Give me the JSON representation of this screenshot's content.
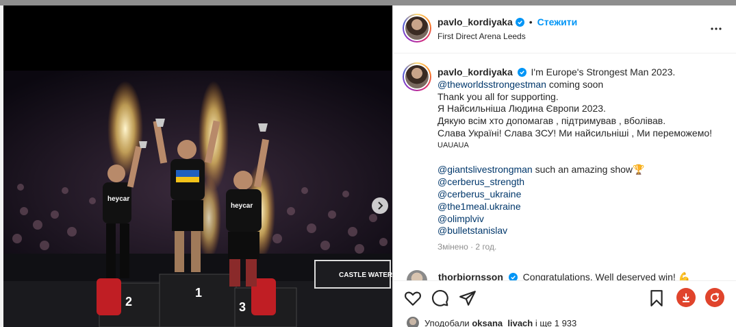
{
  "post": {
    "username": "pavlo_kordiyaka",
    "follow_label": "Стежити",
    "separator": "•",
    "location": "First Direct Arena Leeds",
    "caption_lines": [
      {
        "type": "text",
        "text": "I'm Europe's Strongest Man 2023."
      },
      {
        "type": "mention",
        "text": "@theworldsstrongestman",
        "rest": " coming soon"
      },
      {
        "type": "text",
        "text": "Thank you all for supporting."
      },
      {
        "type": "text",
        "text": "Я Найсильніша Людина Європи 2023."
      },
      {
        "type": "text",
        "text": "Дякую всім хто допомагав , підтримував , вболівав."
      },
      {
        "type": "text",
        "text": "Слава Україні! Слава ЗСУ! Ми найсильніші , Ми переможемо!"
      },
      {
        "type": "small",
        "text": "UAUAUA"
      },
      {
        "type": "gap",
        "text": ""
      },
      {
        "type": "mention",
        "text": "@giantslivestrongman",
        "rest": " such an amazing show🏆"
      },
      {
        "type": "mention",
        "text": "@cerberus_strength",
        "rest": ""
      },
      {
        "type": "mention",
        "text": "@cerberus_ukraine",
        "rest": ""
      },
      {
        "type": "mention",
        "text": "@the1meal.ukraine",
        "rest": ""
      },
      {
        "type": "mention",
        "text": "@olimplviv",
        "rest": ""
      },
      {
        "type": "mention",
        "text": "@bulletstanislav",
        "rest": ""
      }
    ],
    "edited": "Змінено · 2 год."
  },
  "first_comment": {
    "username": "thorbjornsson",
    "text": "Congratulations. Well deserved win! 💪"
  },
  "likes": {
    "prefix": "Уподобали",
    "user": "oksana_livach",
    "suffix": "і ще 1 933"
  },
  "photo": {
    "podium_places": [
      "2",
      "1",
      "3"
    ],
    "sponsor_text": "heycar",
    "banner_text": "CASTLE WATER"
  },
  "colors": {
    "verified_blue": "#0095f6",
    "mention_blue": "#00376b",
    "download_btn": "#e0442c",
    "refresh_btn": "#e0442c"
  },
  "icons": [
    "verified-icon",
    "more-icon",
    "heart-icon",
    "comment-icon",
    "share-icon",
    "bookmark-icon",
    "download-icon",
    "refresh-icon",
    "chevron-right-icon"
  ]
}
